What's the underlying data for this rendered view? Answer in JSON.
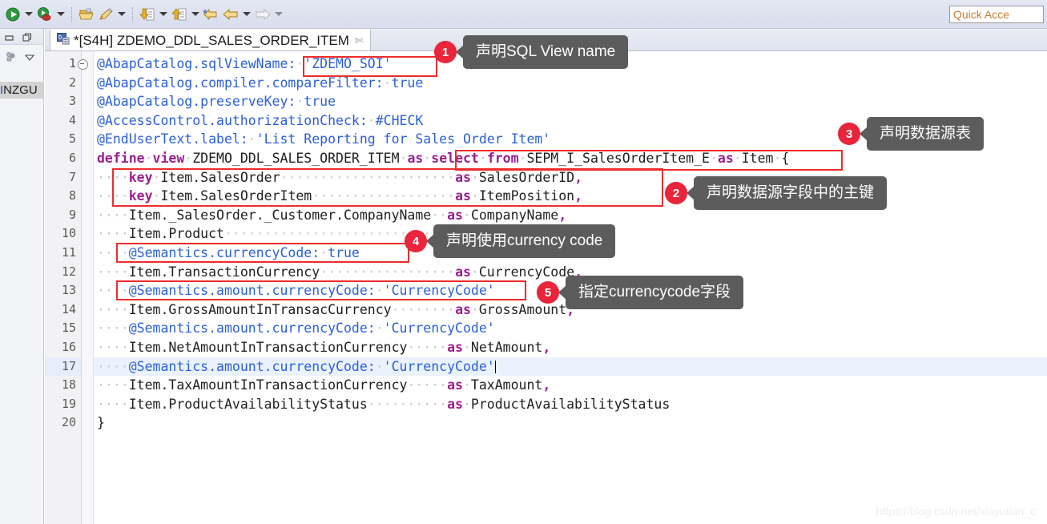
{
  "toolbar": {
    "items": [
      {
        "name": "run-icon",
        "glyph": "run"
      },
      {
        "name": "run-dropdown-arrow",
        "glyph": "caret"
      },
      {
        "name": "debug-icon",
        "glyph": "debug"
      },
      {
        "name": "debug-dropdown-arrow",
        "glyph": "caret"
      },
      {
        "name": "separator",
        "glyph": "sep"
      },
      {
        "name": "open-folder-icon",
        "glyph": "folder"
      },
      {
        "name": "pencil-icon",
        "glyph": "pencil"
      },
      {
        "name": "pencil-dropdown-arrow",
        "glyph": "caret"
      },
      {
        "name": "separator",
        "glyph": "sep"
      },
      {
        "name": "import-download-icon",
        "glyph": "download"
      },
      {
        "name": "import-dropdown-arrow",
        "glyph": "caret"
      },
      {
        "name": "export-upload-icon",
        "glyph": "upload"
      },
      {
        "name": "export-dropdown-arrow",
        "glyph": "caret"
      },
      {
        "name": "back-with-star-icon",
        "glyph": "backstar"
      },
      {
        "name": "back-arrow-icon",
        "glyph": "back"
      },
      {
        "name": "back-dropdown-arrow",
        "glyph": "caret"
      },
      {
        "name": "forward-arrow-icon",
        "glyph": "forward"
      },
      {
        "name": "forward-dropdown-arrow",
        "glyph": "caret-dim"
      }
    ],
    "quick_access_placeholder": "Quick Acce"
  },
  "left_rail": {
    "label_lead": "I",
    "label_rest": "NZGU"
  },
  "tab": {
    "title": "*[S4H] ZDEMO_DDL_SALES_ORDER_ITEM",
    "close_glyph": "✄",
    "icon_name": "ddl-source-icon"
  },
  "editor": {
    "line_count": 20,
    "current_line": 17,
    "fold_line": 1,
    "lines": [
      {
        "n": 1,
        "text": "@AbapCatalog.sqlViewName: 'ZDEMO_SOI'"
      },
      {
        "n": 2,
        "text": "@AbapCatalog.compiler.compareFilter: true"
      },
      {
        "n": 3,
        "text": "@AbapCatalog.preserveKey: true"
      },
      {
        "n": 4,
        "text": "@AccessControl.authorizationCheck: #CHECK"
      },
      {
        "n": 5,
        "text": "@EndUserText.label: 'List Reporting for Sales Order Item'"
      },
      {
        "n": 6,
        "text": "define view ZDEMO_DDL_SALES_ORDER_ITEM as select from SEPM_I_SalesOrderItem_E as Item {"
      },
      {
        "n": 7,
        "text": "    key Item.SalesOrder                      as SalesOrderID,"
      },
      {
        "n": 8,
        "text": "    key Item.SalesOrderItem                  as ItemPosition,"
      },
      {
        "n": 9,
        "text": "    Item._SalesOrder._Customer.CompanyName  as CompanyName,"
      },
      {
        "n": 10,
        "text": "    Item.Product                            as Product,"
      },
      {
        "n": 11,
        "text": "    @Semantics.currencyCode: true"
      },
      {
        "n": 12,
        "text": "    Item.TransactionCurrency                 as CurrencyCode,"
      },
      {
        "n": 13,
        "text": "    @Semantics.amount.currencyCode: 'CurrencyCode'"
      },
      {
        "n": 14,
        "text": "    Item.GrossAmountInTransacCurrency        as GrossAmount,"
      },
      {
        "n": 15,
        "text": "    @Semantics.amount.currencyCode: 'CurrencyCode'"
      },
      {
        "n": 16,
        "text": "    Item.NetAmountInTransactionCurrency     as NetAmount,"
      },
      {
        "n": 17,
        "text": "    @Semantics.amount.currencyCode: 'CurrencyCode'"
      },
      {
        "n": 18,
        "text": "    Item.TaxAmountInTransactionCurrency     as TaxAmount,"
      },
      {
        "n": 19,
        "text": "    Item.ProductAvailabilityStatus          as ProductAvailabilityStatus"
      },
      {
        "n": 20,
        "text": "}"
      }
    ]
  },
  "annotations": {
    "highlight_color": "#ef2b2b",
    "badge_color": "#e8253a",
    "bubble_color": "#5c5c5c",
    "callouts": [
      {
        "number": "1",
        "text": "声明SQL View name"
      },
      {
        "number": "2",
        "text": "声明数据源字段中的主键"
      },
      {
        "number": "3",
        "text": "声明数据源表"
      },
      {
        "number": "4",
        "text": "声明使用currency code"
      },
      {
        "number": "5",
        "text": "指定currencycode字段"
      }
    ]
  },
  "watermark": {
    "text": "https://blog.csdn.net/xiayutian_c"
  }
}
